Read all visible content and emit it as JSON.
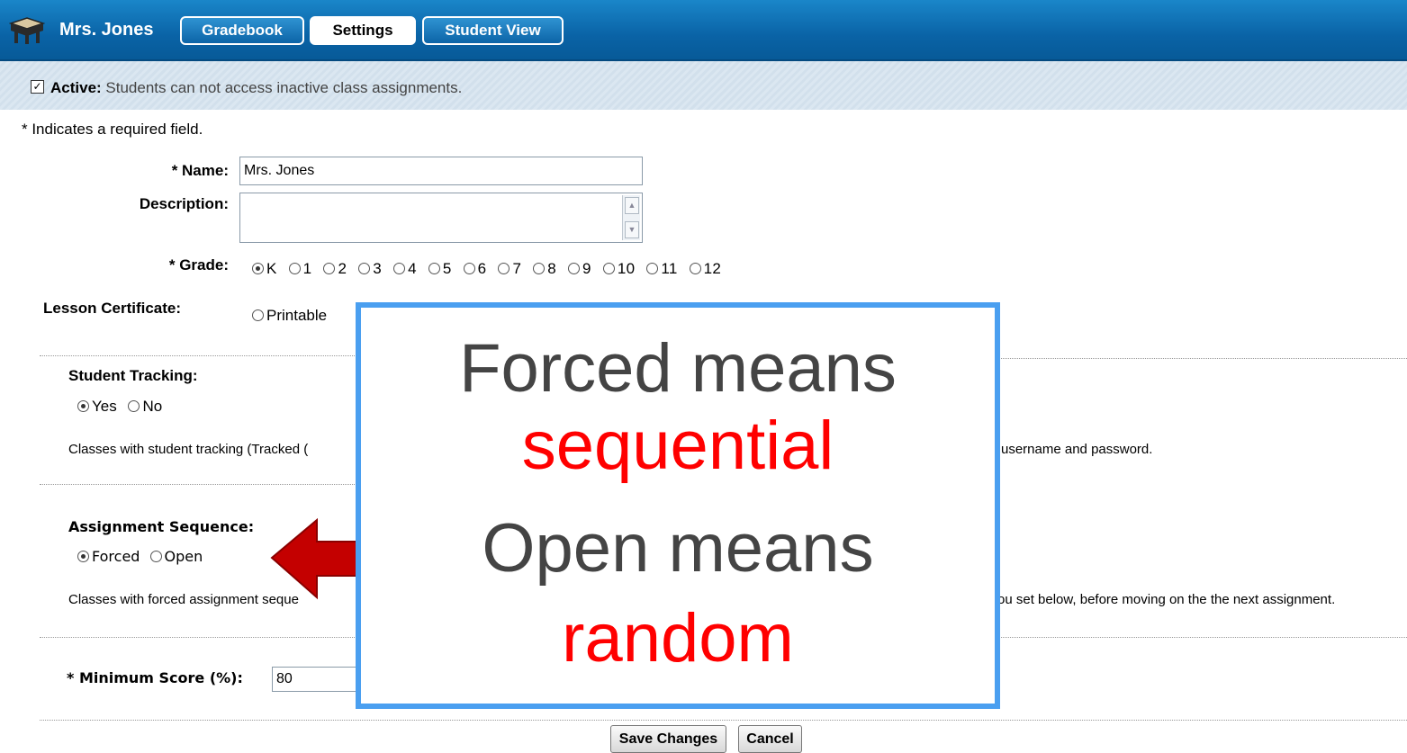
{
  "header": {
    "teacher_name": "Mrs. Jones",
    "tabs": [
      {
        "label": "Gradebook",
        "active": false
      },
      {
        "label": "Settings",
        "active": true
      },
      {
        "label": "Student View",
        "active": false
      }
    ]
  },
  "active_bar": {
    "checked": true,
    "label": "Active:",
    "text": " Students can not access inactive class assignments."
  },
  "required_note": "* Indicates a required field.",
  "form": {
    "name_label": "* Name:",
    "name_value": "Mrs. Jones",
    "description_label": "Description:",
    "description_value": "",
    "grade_label": "* Grade:",
    "grades": [
      "K",
      "1",
      "2",
      "3",
      "4",
      "5",
      "6",
      "7",
      "8",
      "9",
      "10",
      "11",
      "12"
    ],
    "grade_selected": "K",
    "certificate_label": "Lesson Certificate:",
    "certificate_option": "Printable",
    "tracking_label": "Student Tracking:",
    "tracking_yes": "Yes",
    "tracking_no": "No",
    "tracking_selected": "Yes",
    "tracking_desc_left": "Classes with student tracking (Tracked (",
    "tracking_desc_right": "username and password.",
    "sequence_label": "Assignment Sequence:",
    "sequence_forced": "Forced",
    "sequence_open": "Open",
    "sequence_selected": "Forced",
    "sequence_desc_left": "Classes with forced assignment seque",
    "sequence_desc_right": "ou set below, before moving on the the next assignment.",
    "min_score_label": "* Minimum Score (%):",
    "min_score_value": "80"
  },
  "buttons": {
    "save": "Save Changes",
    "cancel": "Cancel"
  },
  "overlay": {
    "line1": "Forced means",
    "line2": "sequential",
    "line3": "Open means",
    "line4": "random",
    "border_color": "#4a9ff0",
    "highlight_color": "#ff0000"
  }
}
